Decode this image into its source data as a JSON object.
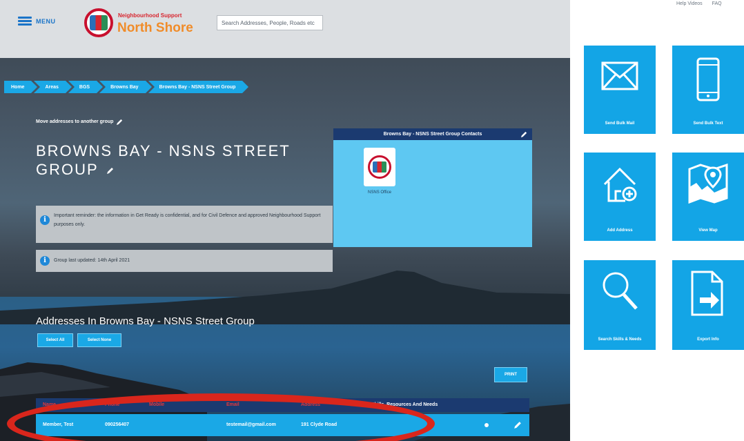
{
  "header": {
    "menu_label": "MENU",
    "brand_top": "Neighbourhood Support",
    "brand_main": "North Shore",
    "search_placeholder": "Search Addresses, People, Roads etc"
  },
  "top_links": [
    "Help Videos",
    "FAQ"
  ],
  "breadcrumb": [
    "Home",
    "Areas",
    "BGS",
    "Browns Bay",
    "Browns Bay - NSNS Street Group"
  ],
  "move_link": "Move addresses to another group",
  "group_title": "BROWNS BAY - NSNS STREET GROUP",
  "notices": {
    "confidential": "Important reminder: the information in Get Ready is confidential, and for Civil Defence and approved Neighbourhood Support purposes only.",
    "updated": "Group last updated: 14th April 2021"
  },
  "contacts": {
    "title": "Browns Bay - NSNS Street Group Contacts",
    "contact_name": "NSNS Office"
  },
  "addresses": {
    "title": "Addresses In Browns Bay - NSNS Street Group",
    "select_all": "Select All",
    "select_none": "Select None",
    "print": "PRINT"
  },
  "table": {
    "columns": [
      "Name",
      "Phone",
      "Mobile",
      "Email",
      "Address",
      "Skills, Resources And Needs"
    ],
    "rows": [
      {
        "name": "Member, Test",
        "phone": "090256407",
        "mobile": "",
        "email": "testemail@gmail.com",
        "address": "191 Clyde Road",
        "skills": ""
      }
    ]
  },
  "tiles": {
    "send_bulk_mail": "Send Bulk Mail",
    "send_bulk_text": "Send Bulk Text",
    "add_address": "Add Address",
    "view_map": "View Map",
    "search_skills": "Search Skills & Needs",
    "export_info": "Export Info"
  },
  "colors": {
    "accent": "#13a5e6",
    "dark_header": "#1b3a70",
    "highlight": "#d9261c"
  }
}
